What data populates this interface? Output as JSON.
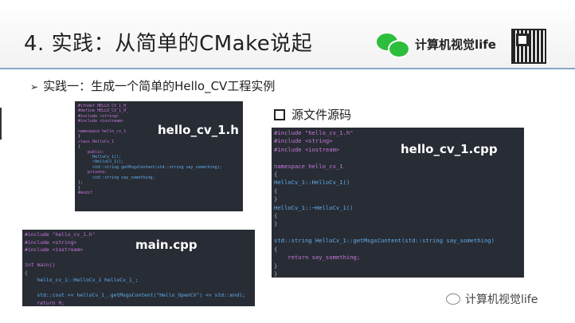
{
  "title": "4. 实践：从简单的CMake说起",
  "brand": "计算机视觉life",
  "bullet": "实践一：生成一个简单的Hello_CV工程实例",
  "source_label": "源文件源码",
  "panel1_label": "hello_cv_1.h",
  "panel2_label": "hello_cv_1.cpp",
  "panel3_label": "main.cpp",
  "panel1_lines": [
    "#ifndef HELLO_CV_1_H_",
    "#define HELLO_CV_1_H_",
    "#include <string>",
    "#include <iostream>",
    "",
    "namespace hello_cv_1",
    "{",
    "class HelloCv_1",
    "{",
    "    public:",
    "      HelloCv_1();",
    "      ~HelloCv_1();",
    "      std::string getMsgsContent(std::string say_something);",
    "    private:",
    "      std::string say_something;",
    "};",
    "}",
    "#endif"
  ],
  "panel2_lines": [
    "#include \"hello_cv_1.h\"",
    "#include <string>",
    "#include <iostream>",
    "",
    "namespace hello_cv_1",
    "{",
    "HelloCv_1::HelloCv_1()",
    "{",
    "}",
    "HelloCv_1::~HelloCv_1()",
    "{",
    "}",
    "",
    "std::string HelloCv_1::getMsgsContent(std::string say_something)",
    "{",
    "    return say_something;",
    "}",
    "}"
  ],
  "panel3_lines": [
    "#include \"hello_cv_1.h\"",
    "#include <string>",
    "#include <iostream>",
    "",
    "int main()",
    "{",
    "    hello_cv_1::HelloCv_1 helloCv_1_;",
    "",
    "    std::cout << helloCv_1_.getMsgsContent(\"Hello_OpenCV\") << std::endl;",
    "    return 0;",
    "}"
  ],
  "footer": "计算机视觉life",
  "colors": {
    "code_bg": "#282c34",
    "accent_green": "#2dbe3c",
    "divider": "#8aa6c8"
  }
}
